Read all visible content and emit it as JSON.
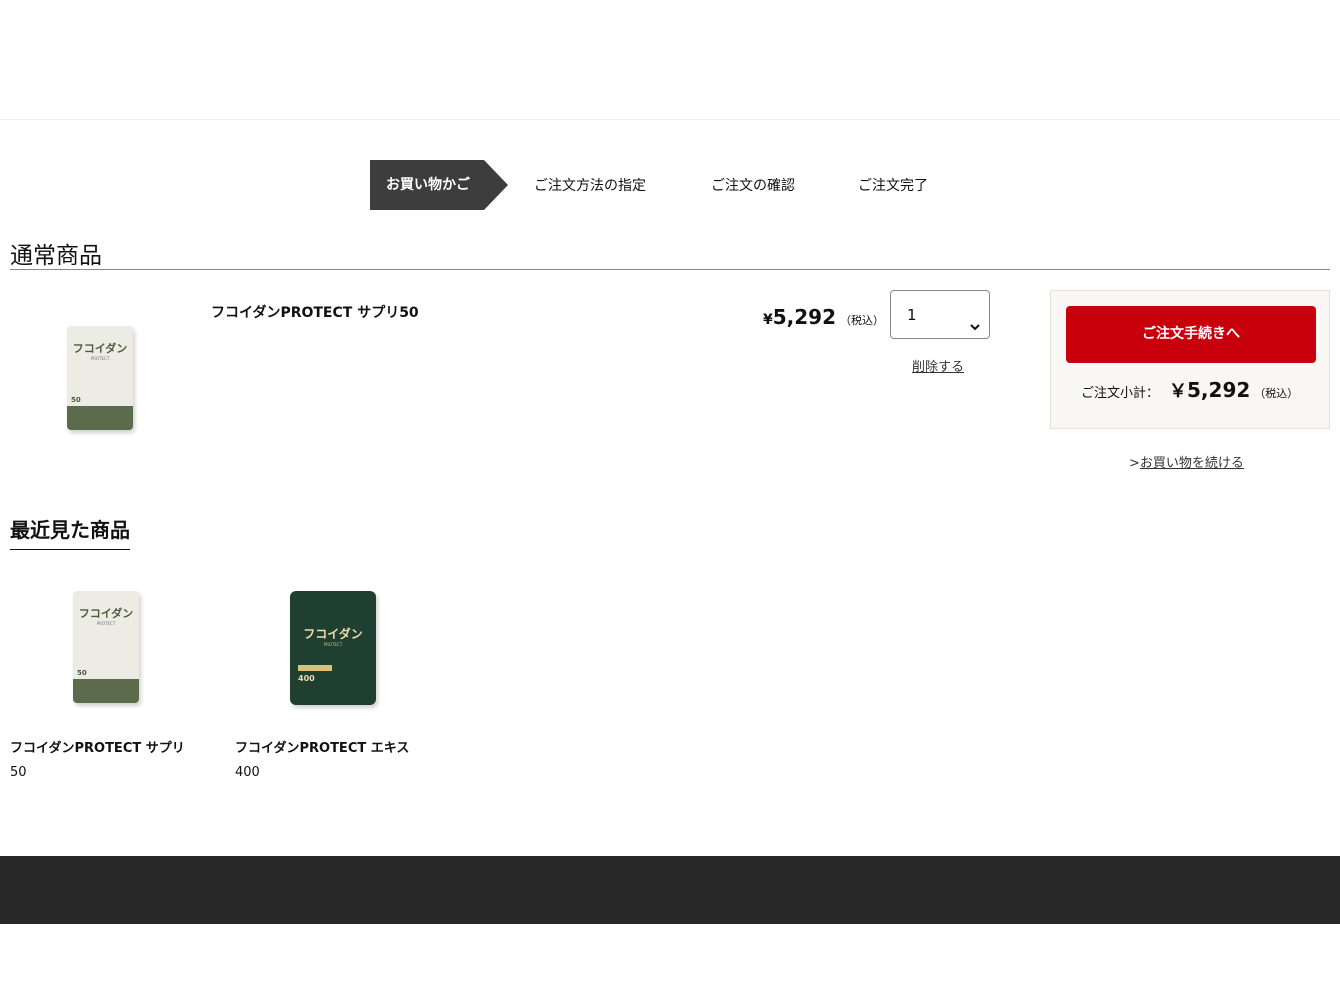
{
  "steps": {
    "active": "お買い物かご",
    "items": [
      "ご注文方法の指定",
      "ご注文の確認",
      "ご注文完了"
    ]
  },
  "cart": {
    "section_title": "通常商品",
    "item": {
      "name": "フコイダンPROTECT サプリ50",
      "price_symbol": "¥",
      "price": "5,292",
      "tax_note": "（税込）",
      "quantity": "1",
      "delete_label": "削除する"
    }
  },
  "summary": {
    "checkout_label": "ご注文手続きへ",
    "subtotal_label": "ご注文小計：",
    "subtotal_symbol": "￥",
    "subtotal_value": "5,292",
    "tax_note": "（税込）",
    "continue_prefix": ">",
    "continue_label": "お買い物を続ける"
  },
  "product_images": {
    "supplement": {
      "name": "フコイダン",
      "sub": "PROTECT",
      "badge": "50"
    },
    "extract": {
      "name": "フコイダン",
      "sub": "PROTECT",
      "badge": "400"
    }
  },
  "recent": {
    "section_title": "最近見た商品",
    "items": [
      {
        "name_line1": "フコイダンPROTECT サプリ",
        "name_line2": "50"
      },
      {
        "name_line1": "フコイダンPROTECT エキス",
        "name_line2": "400"
      }
    ]
  }
}
